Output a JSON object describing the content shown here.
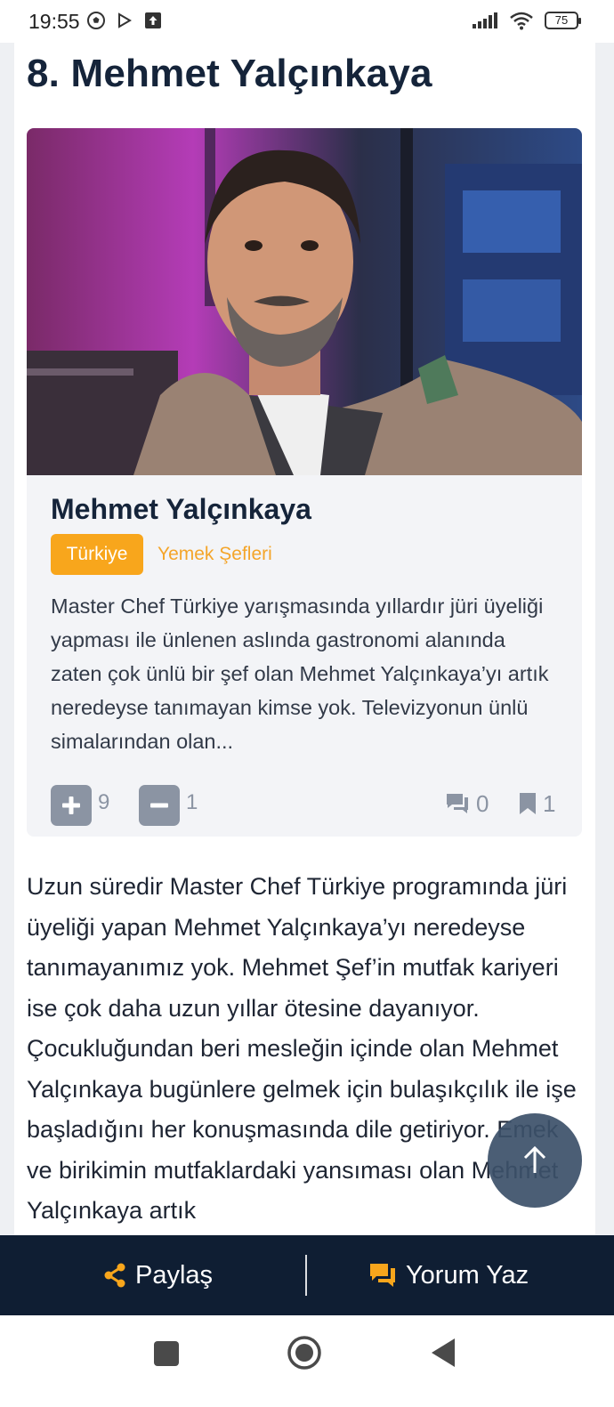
{
  "status_bar": {
    "time": "19:55",
    "battery": "75",
    "icons": [
      "soccer-ball-icon",
      "play-store-icon",
      "upload-icon",
      "signal-icon",
      "wifi-icon",
      "battery-icon"
    ]
  },
  "article": {
    "section_title": "8. Mehmet Yalçınkaya",
    "card": {
      "photo_alt": "Mehmet Yalçınkaya",
      "name": "Mehmet Yalçınkaya",
      "country_tag": "Türkiye",
      "category": "Yemek Şefleri",
      "description": "Master Chef Türkiye yarışmasında yıllardır jüri üyeliği yapması ile ünlenen aslında gastronomi alanında zaten çok ünlü bir şef olan Mehmet Yalçınkaya’yı artık neredeyse tanımayan kimse yok. Televizyonun ünlü simalarından olan...",
      "upvotes": "9",
      "downvotes": "1",
      "comments": "0",
      "bookmarks": "1"
    },
    "body_text": "Uzun süredir Master Chef Türkiye programında jüri üyeliği yapan Mehmet Yalçınkaya’yı neredeyse tanımayanımız yok. Mehmet Şef’in mutfak kariyeri ise çok daha uzun yıllar ötesine dayanıyor. Çocukluğundan beri mesleğin içinde olan Mehmet Yalçınkaya bugünlere gelmek için bulaşıkçılık ile işe başladığını her konuşmasında dile getiriyor. Emek ve birikimin mutfaklardaki yansıması olan Mehmet Yalçınkaya artık"
  },
  "action_bar": {
    "share_label": "Paylaş",
    "comment_label": "Yorum Yaz"
  },
  "colors": {
    "accent": "#f8a61c",
    "dark_bar": "#0f1e33",
    "muted": "#8b94a3"
  }
}
